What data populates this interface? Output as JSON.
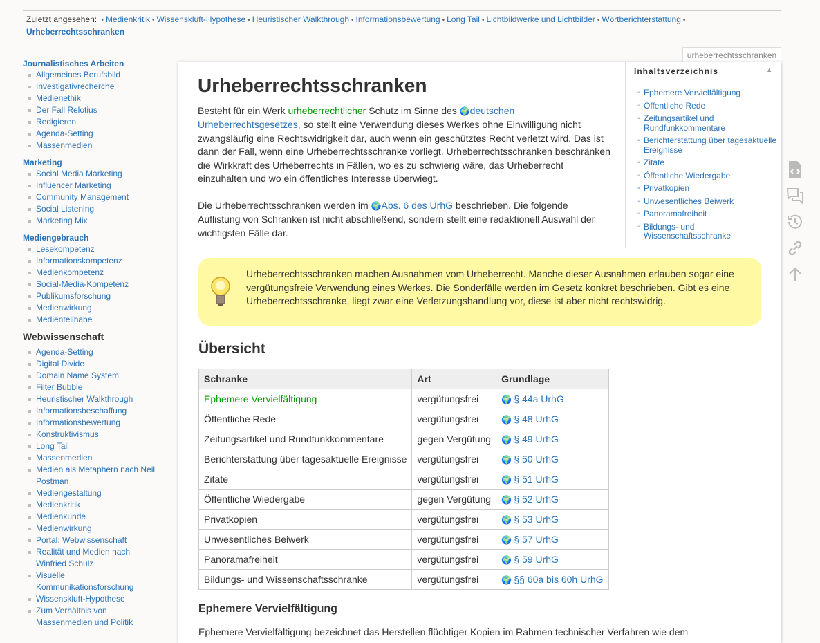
{
  "breadcrumbs": {
    "label": "Zuletzt angesehen:",
    "items": [
      "Medienkritik",
      "Wissenskluft-Hypothese",
      "Heuristischer Walkthrough",
      "Informationsbewertung",
      "Long Tail",
      "Lichtbildwerke und Lichtbilder",
      "Wortberichterstattung"
    ],
    "current": "Urheberrechtsschranken"
  },
  "sidebar": {
    "sections": [
      {
        "title": "Journalistisches Arbeiten",
        "items": [
          "Allgemeines Berufsbild",
          "Investigativrecherche",
          "Medienethik",
          "Der Fall Relotius",
          "Redigieren",
          "Agenda-Setting",
          "Massenmedien"
        ]
      },
      {
        "title": "Marketing",
        "items": [
          "Social Media Marketing",
          "Influencer Marketing",
          "Community Management",
          "Social Listening",
          "Marketing Mix"
        ]
      },
      {
        "title": "Mediengebrauch",
        "items": [
          "Lesekompetenz",
          "Informationskompetenz",
          "Medienkompetenz",
          "Social-Media-Kompetenz",
          "Publikumsforschung",
          "Medienwirkung",
          "Medienteilhabe"
        ]
      }
    ],
    "webwissenschaft": {
      "title": "Webwissenschaft",
      "items": [
        "Agenda-Setting",
        "Digital Divide",
        "Domain Name System",
        "Filter Bubble",
        "Heuristischer Walkthrough",
        "Informationsbeschaffung",
        "Informationsbewertung",
        "Konstruktivismus",
        "Long Tail",
        "Massenmedien",
        "Medien als Metaphern nach Neil Postman",
        "Mediengestaltung",
        "Medienkritik",
        "Medienkunde",
        "Medienwirkung",
        "Portal: Webwissenschaft",
        "Realität und Medien nach Winfried Schulz",
        "Visuelle Kommunikationsforschung",
        "Wissenskluft-Hypothese",
        "Zum Verhältnis von Massenmedien und Politik"
      ]
    }
  },
  "page_id": "urheberrechtsschranken",
  "title": "Urheberrechtsschranken",
  "intro": {
    "t1": "Besteht für ein Werk ",
    "l1": "urheberrechtlicher",
    "t2": " Schutz im Sinne des ",
    "l2": "deutschen Urheberrechtsgesetzes",
    "t3": ", so stellt eine Verwendung dieses Werkes ohne Einwilligung nicht zwangsläufig eine Rechtswidrigkeit dar, auch wenn ein geschütztes Recht verletzt wird. Das ist dann der Fall, wenn eine Urheberrechtsschranke vorliegt. Urheberrechtsschranken beschränken die Wirkkraft des Urheberrechts in Fällen, wo es zu schwierig wäre, das Urheberrecht einzuhalten und wo ein öffentliches Interesse überwiegt."
  },
  "p2": {
    "t1": "Die Urheberrechtsschranken werden im ",
    "l1": "Abs. 6 des UrhG",
    "t2": " beschrieben. Die folgende Auflistung von Schranken ist nicht abschließend, sondern stellt eine redaktionell Auswahl der wichtigsten Fälle dar."
  },
  "toc": {
    "title": "Inhaltsverzeichnis",
    "items": [
      "Ephemere Vervielfältigung",
      "Öffentliche Rede",
      "Zeitungsartikel und Rundfunkkommentare",
      "Berichterstattung über tagesaktuelle Ereignisse",
      "Zitate",
      "Öffentliche Wiedergabe",
      "Privatkopien",
      "Unwesentliches Beiwerk",
      "Panoramafreiheit",
      "Bildungs- und Wissenschaftsschranke"
    ]
  },
  "tip": "Urheberrechtsschranken machen Ausnahmen vom Urheberrecht. Manche dieser Ausnahmen erlauben sogar eine vergütungsfreie Verwendung eines Werkes. Die Sonderfälle werden im Gesetz konkret beschrieben. Gibt es eine Urheberrechtsschranke, liegt zwar eine Verletzungshandlung vor, diese ist aber nicht rechtswidrig.",
  "overview_heading": "Übersicht",
  "table": {
    "headers": [
      "Schranke",
      "Art",
      "Grundlage"
    ],
    "rows": [
      [
        "Ephemere Vervielfältigung",
        "vergütungsfrei",
        "§ 44a UrhG"
      ],
      [
        "Öffentliche Rede",
        "vergütungsfrei",
        "§ 48 UrhG"
      ],
      [
        "Zeitungsartikel und Rundfunkkommentare",
        "gegen Vergütung",
        "§ 49 UrhG"
      ],
      [
        "Berichterstattung über tagesaktuelle Ereignisse",
        "vergütungsfrei",
        "§ 50 UrhG"
      ],
      [
        "Zitate",
        "vergütungsfrei",
        "§ 51 UrhG"
      ],
      [
        "Öffentliche Wiedergabe",
        "gegen Vergütung",
        "§ 52 UrhG"
      ],
      [
        "Privatkopien",
        "vergütungsfrei",
        "§ 53 UrhG"
      ],
      [
        "Unwesentliches Beiwerk",
        "vergütungsfrei",
        "§ 57 UrhG"
      ],
      [
        "Panoramafreiheit",
        "vergütungsfrei",
        "§ 59 UrhG"
      ],
      [
        "Bildungs- und Wissenschaftsschranke",
        "vergütungsfrei",
        "§§ 60a bis 60h UrhG"
      ]
    ]
  },
  "section_heading": "Ephemere Vervielfältigung",
  "section_text": "Ephemere Vervielfältigung bezeichnet das Herstellen flüchtiger Kopien im Rahmen technischer Verfahren wie dem",
  "tools": [
    "show-source-icon",
    "discussion-icon",
    "old-revisions-icon",
    "backlinks-icon",
    "back-to-top-icon"
  ]
}
